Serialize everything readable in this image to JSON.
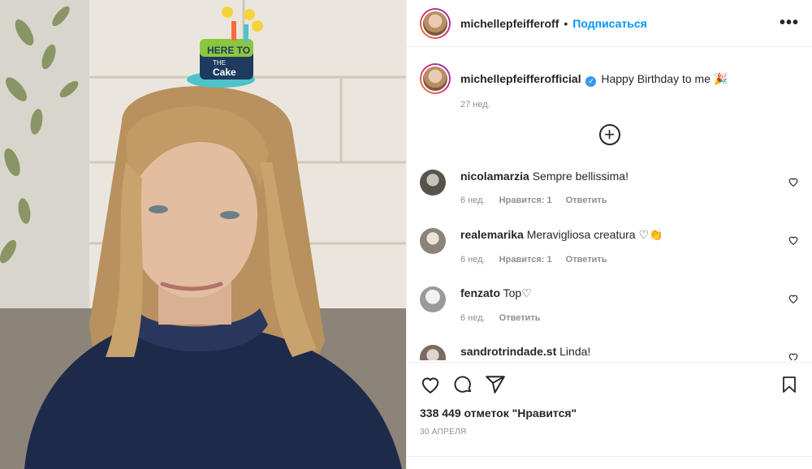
{
  "post": {
    "author": "michellepfeifferoff",
    "follow_label": "Подписаться",
    "separator": "•",
    "more_label": "•••"
  },
  "caption": {
    "username": "michellepfeifferofficial",
    "text": "Happy Birthday to me 🎉",
    "time": "27 нед."
  },
  "photo": {
    "hat_text_1": "HERE TO",
    "hat_text_2": "THE",
    "hat_text_3": "Cake"
  },
  "comments": [
    {
      "username": "nicolamarzia",
      "text": "Sempre bellissima!",
      "time": "6 нед.",
      "likes": "Нравится: 1",
      "reply": "Ответить"
    },
    {
      "username": "realemarika",
      "text": "Meravigliosa creatura ♡👏",
      "time": "6 нед.",
      "likes": "Нравится: 1",
      "reply": "Ответить"
    },
    {
      "username": "fenzato",
      "text": "Top♡",
      "time": "6 нед.",
      "reply": "Ответить"
    },
    {
      "username": "sandrotrindade.st",
      "text": "Linda!"
    }
  ],
  "stats": {
    "likes": "338 449 отметок \"Нравится\"",
    "date": "30 АПРЕЛЯ"
  }
}
